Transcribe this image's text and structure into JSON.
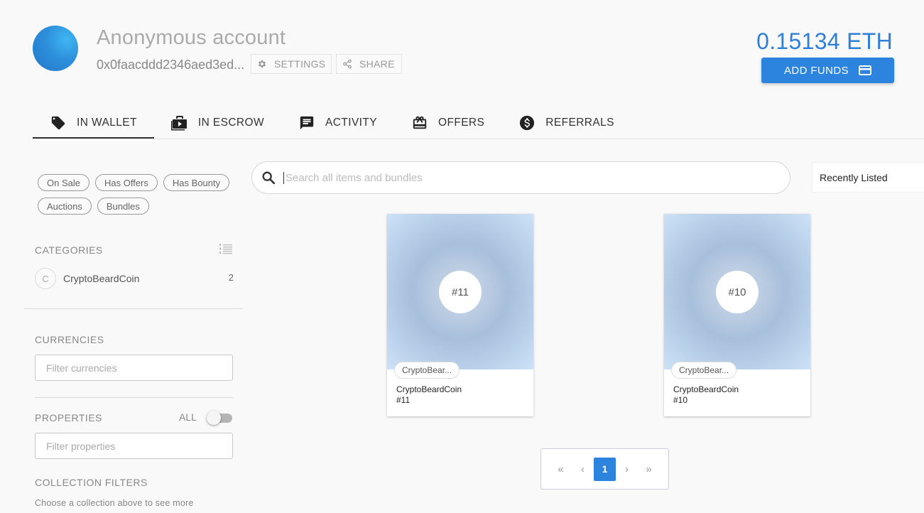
{
  "account": {
    "name": "Anonymous account",
    "address": "0x0faacddd2346aed3ed...",
    "settings_label": "SETTINGS",
    "share_label": "SHARE",
    "balance": "0.15134 ETH",
    "add_funds_label": "ADD FUNDS"
  },
  "tabs": [
    {
      "label": "IN WALLET",
      "icon": "tag-icon",
      "active": true
    },
    {
      "label": "IN ESCROW",
      "icon": "briefcase-icon",
      "active": false
    },
    {
      "label": "ACTIVITY",
      "icon": "message-icon",
      "active": false
    },
    {
      "label": "OFFERS",
      "icon": "gift-card-icon",
      "active": false
    },
    {
      "label": "REFERRALS",
      "icon": "dollar-circle-icon",
      "active": false
    }
  ],
  "sidebar": {
    "chips": [
      "On Sale",
      "Has Offers",
      "Has Bounty",
      "Auctions",
      "Bundles"
    ],
    "categories_title": "CATEGORIES",
    "categories": [
      {
        "initial": "C",
        "name": "CryptoBeardCoin",
        "count": "2"
      }
    ],
    "currencies_title": "CURRENCIES",
    "currencies_placeholder": "Filter currencies",
    "properties_title": "PROPERTIES",
    "properties_all_label": "ALL",
    "properties_placeholder": "Filter properties",
    "collection_filters_title": "COLLECTION FILTERS",
    "collection_filters_hint": "Choose a collection above to see more"
  },
  "main": {
    "search_placeholder": "Search all items and bundles",
    "sort_value": "Recently Listed",
    "items": [
      {
        "badge": "#11",
        "tag": "CryptoBear...",
        "title": "CryptoBeardCoin",
        "sub": "#11"
      },
      {
        "badge": "#10",
        "tag": "CryptoBear...",
        "title": "CryptoBeardCoin",
        "sub": "#10"
      }
    ],
    "pagination": {
      "first": "«",
      "prev": "‹",
      "current": "1",
      "next": "›",
      "last": "»"
    }
  }
}
